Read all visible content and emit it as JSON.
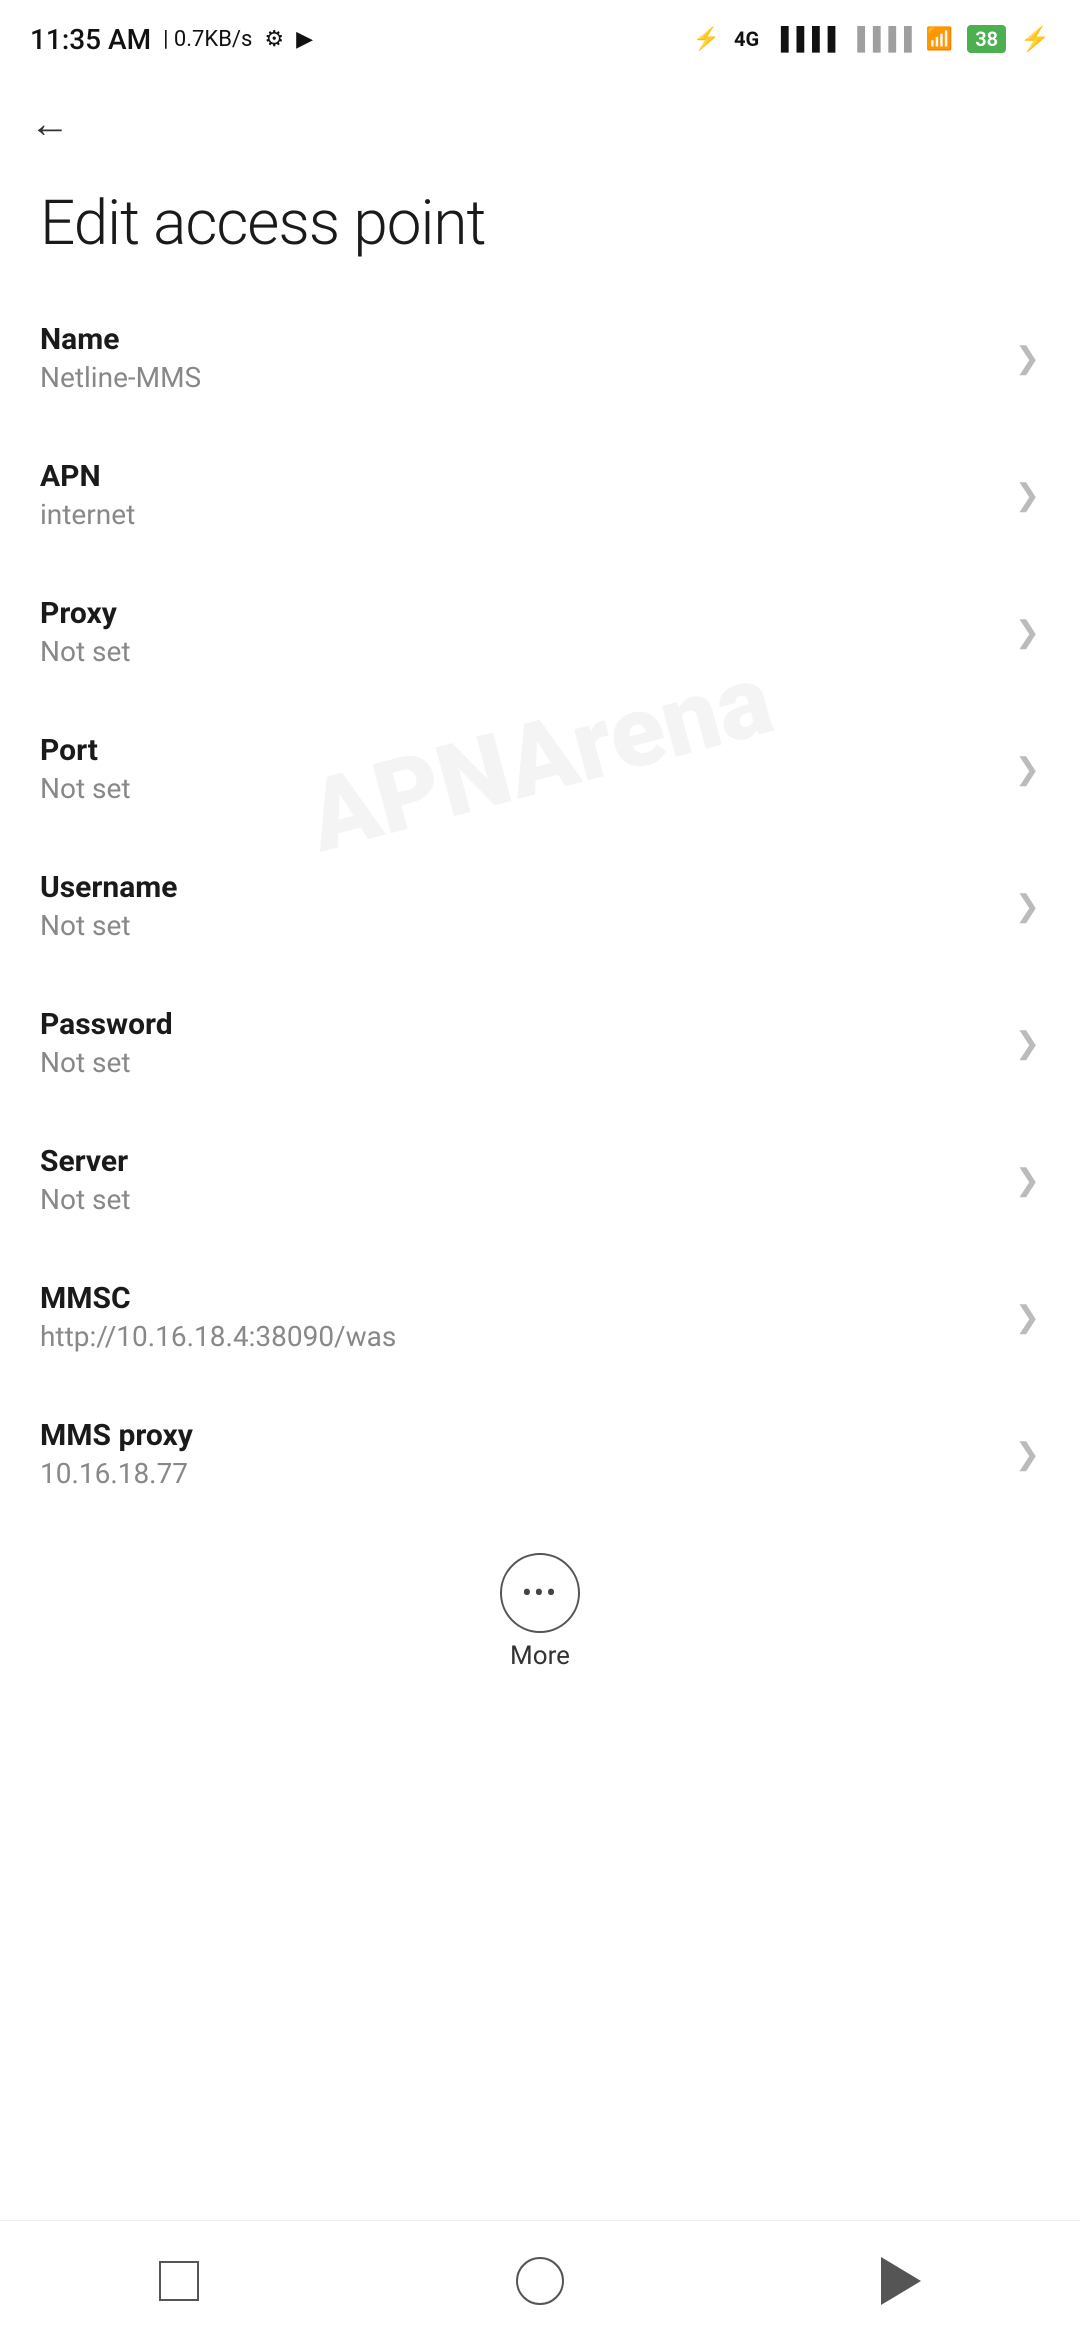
{
  "statusBar": {
    "time": "11:35 AM",
    "speed": "0.7KB/s"
  },
  "header": {
    "backLabel": "←",
    "title": "Edit access point"
  },
  "settings": [
    {
      "label": "Name",
      "value": "Netline-MMS"
    },
    {
      "label": "APN",
      "value": "internet"
    },
    {
      "label": "Proxy",
      "value": "Not set"
    },
    {
      "label": "Port",
      "value": "Not set"
    },
    {
      "label": "Username",
      "value": "Not set"
    },
    {
      "label": "Password",
      "value": "Not set"
    },
    {
      "label": "Server",
      "value": "Not set"
    },
    {
      "label": "MMSC",
      "value": "http://10.16.18.4:38090/was"
    },
    {
      "label": "MMS proxy",
      "value": "10.16.18.77"
    }
  ],
  "more": {
    "label": "More"
  },
  "watermark": "APNArena"
}
